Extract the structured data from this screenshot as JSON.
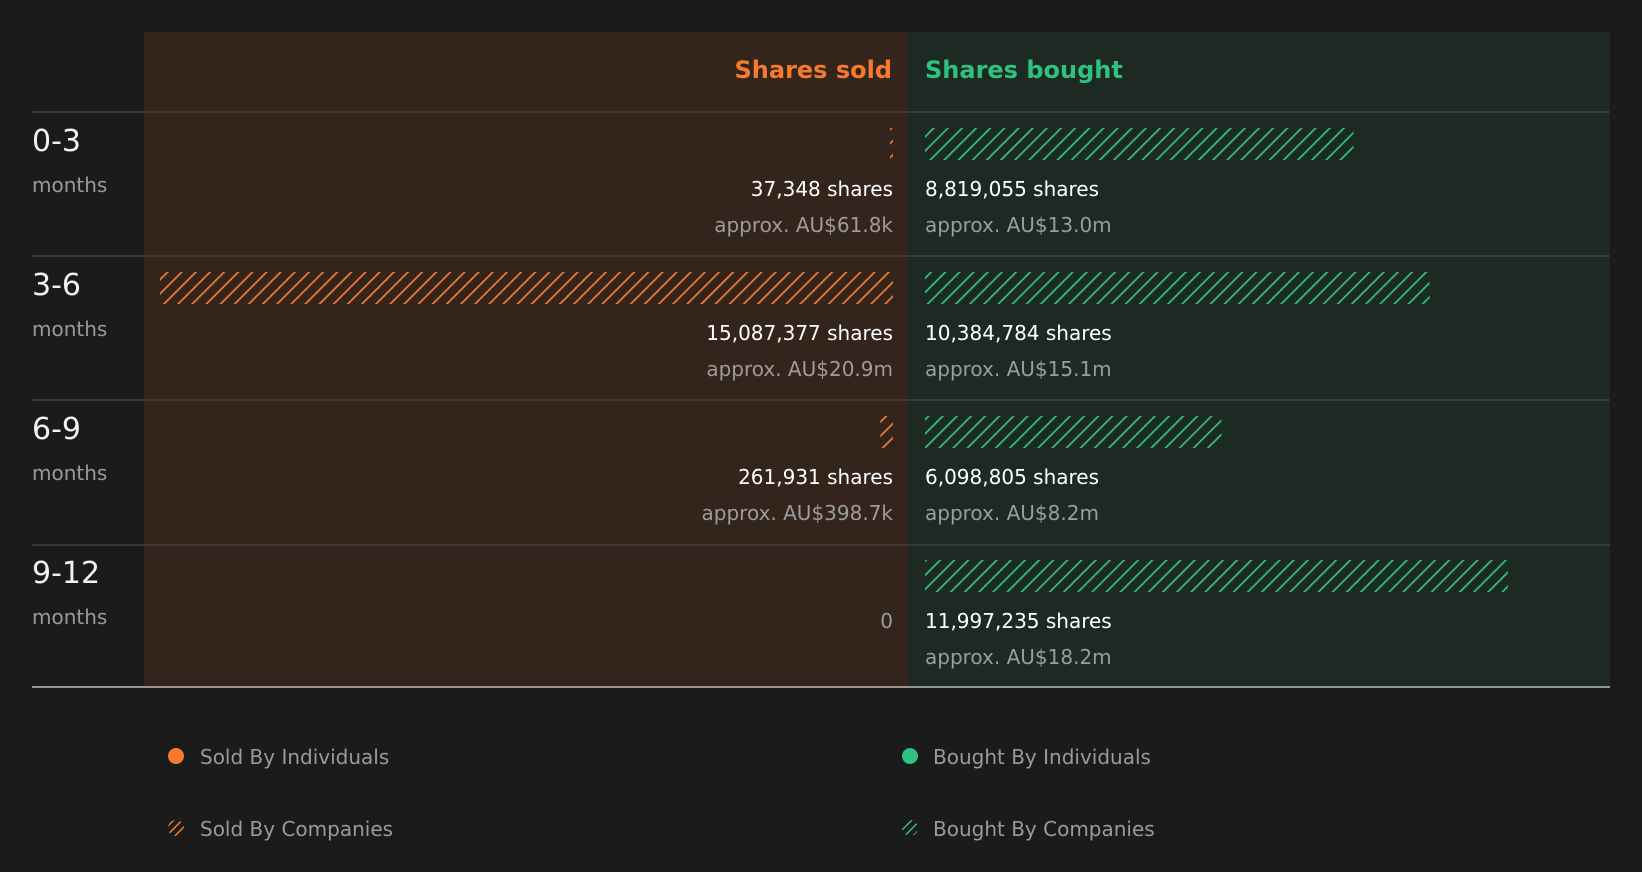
{
  "colors": {
    "sold": "#f6792d",
    "bought": "#2ec27e",
    "sold_bg": "#33241c",
    "bought_bg": "#1d2a24",
    "background": "#1b1b1b"
  },
  "chart_data": {
    "type": "bar",
    "headers": {
      "sold": "Shares sold",
      "bought": "Shares bought"
    },
    "categories": [
      {
        "period": "0-3",
        "unit": "months"
      },
      {
        "period": "3-6",
        "unit": "months"
      },
      {
        "period": "6-9",
        "unit": "months"
      },
      {
        "period": "9-12",
        "unit": "months"
      }
    ],
    "series": [
      {
        "name": "Shares sold",
        "values": [
          37348,
          15087377,
          261931,
          0
        ],
        "share_labels": [
          "37,348 shares",
          "15,087,377 shares",
          "261,931 shares",
          "0"
        ],
        "value_labels": [
          "approx. AU$61.8k",
          "approx. AU$20.9m",
          "approx. AU$398.7k",
          ""
        ]
      },
      {
        "name": "Shares bought",
        "values": [
          8819055,
          10384784,
          6098805,
          11997235
        ],
        "share_labels": [
          "8,819,055 shares",
          "10,384,784 shares",
          "6,098,805 shares",
          "11,997,235 shares"
        ],
        "value_labels": [
          "approx. AU$13.0m",
          "approx. AU$15.1m",
          "approx. AU$8.2m",
          "approx. AU$18.2m"
        ]
      }
    ],
    "legend": [
      {
        "label": "Sold By Individuals",
        "color": "#f6792d",
        "style": "solid"
      },
      {
        "label": "Bought By Individuals",
        "color": "#2ec27e",
        "style": "solid"
      },
      {
        "label": "Sold By Companies",
        "color": "#f6792d",
        "style": "hatched"
      },
      {
        "label": "Bought By Companies",
        "color": "#2ec27e",
        "style": "hatched"
      }
    ]
  }
}
